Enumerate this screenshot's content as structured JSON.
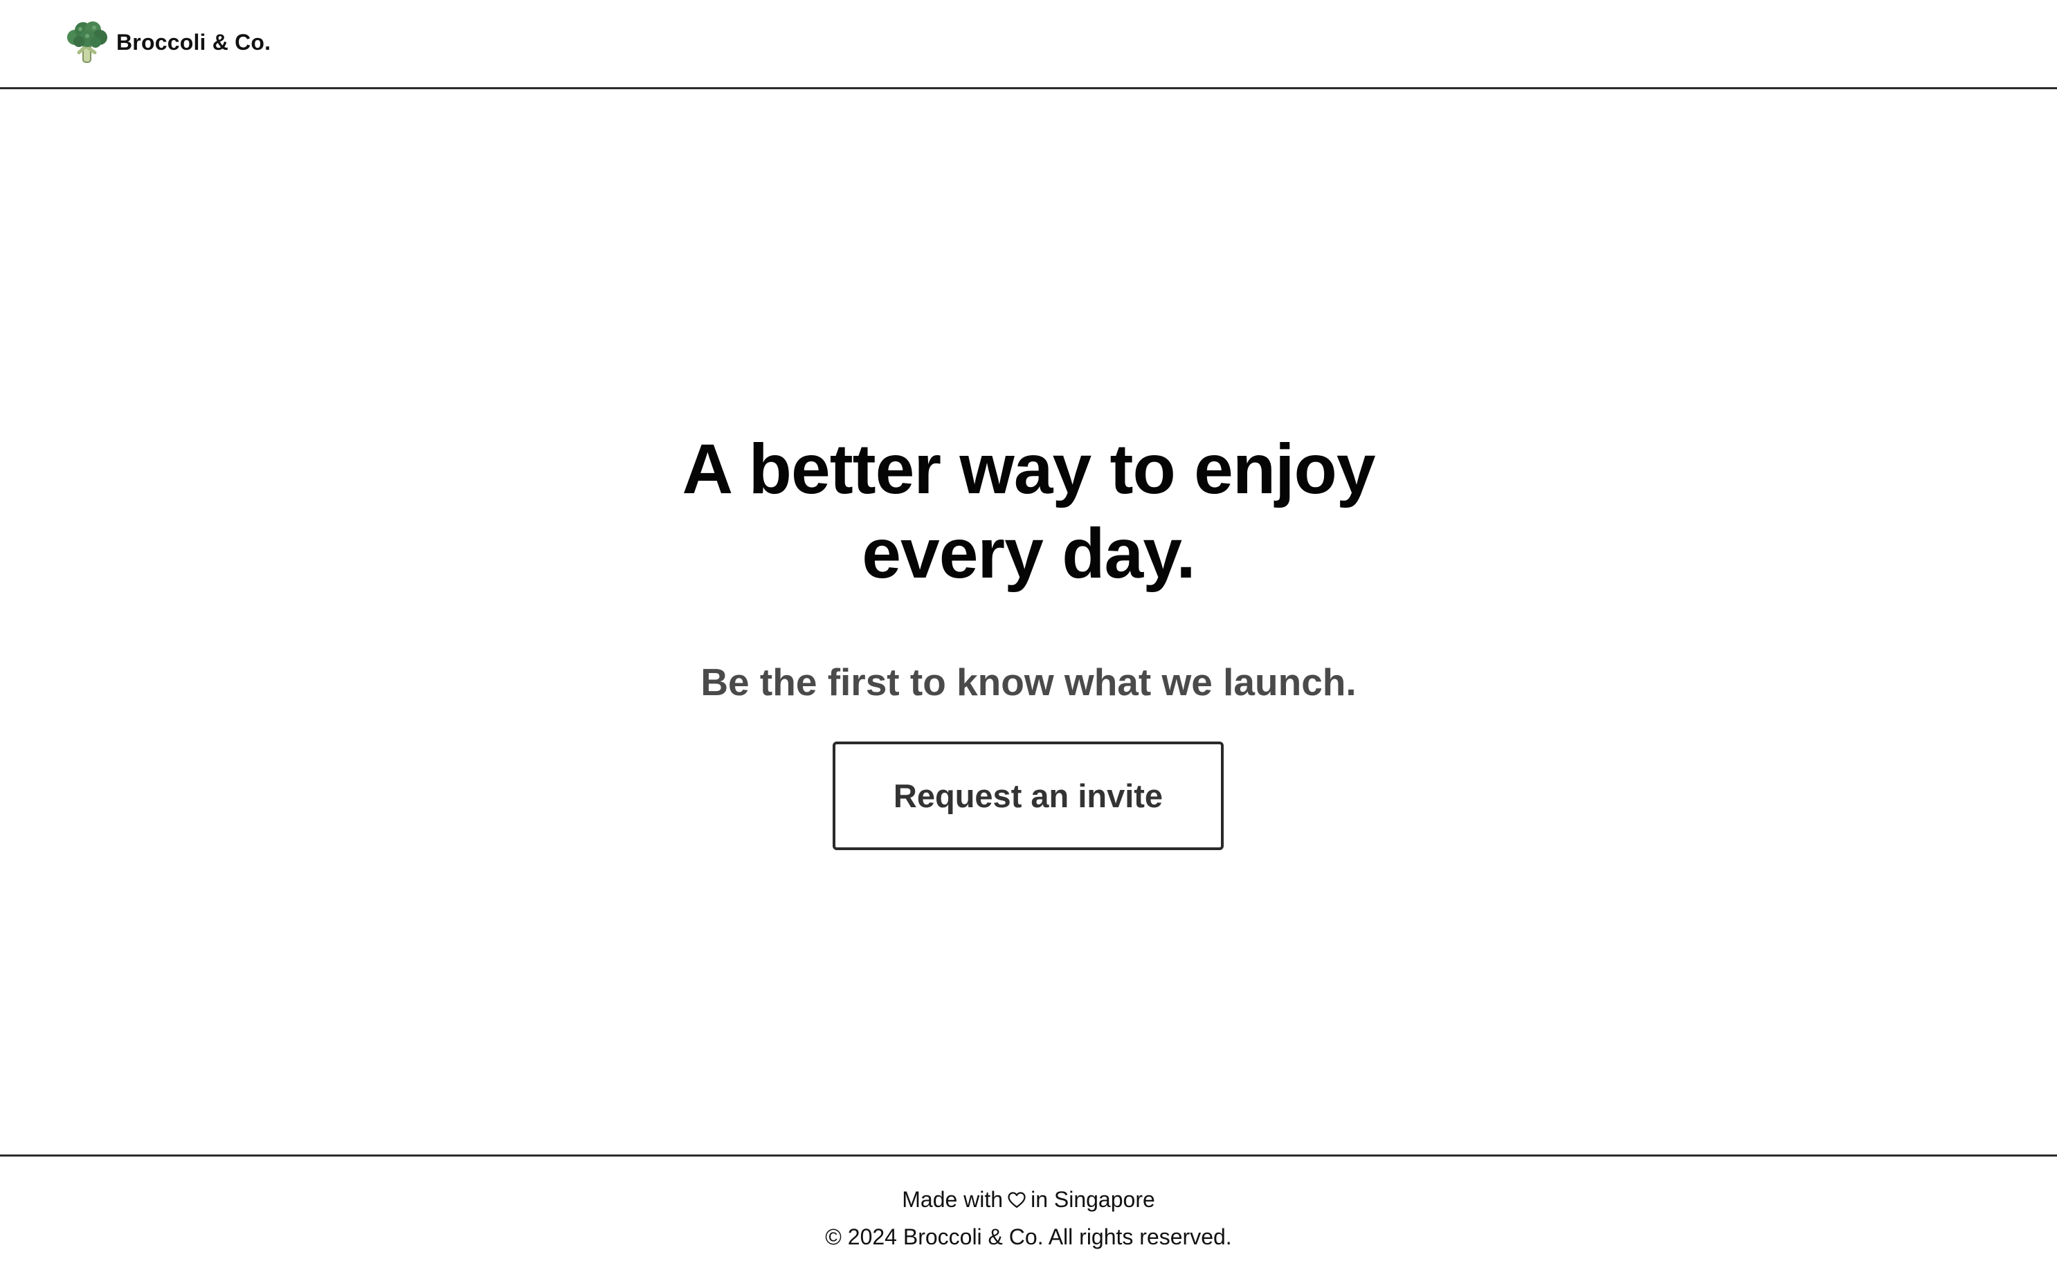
{
  "header": {
    "brand_name": "Broccoli & Co.",
    "logo_icon": "broccoli-icon"
  },
  "hero": {
    "headline_line1": "A better way to enjoy",
    "headline_line2": "every day.",
    "subhead": "Be the first to know what we launch.",
    "cta_label": "Request an invite"
  },
  "footer": {
    "made_with_prefix": "Made with",
    "heart_icon": "heart-icon",
    "made_with_suffix": "in Singapore",
    "copyright": "© 2024 Broccoli & Co. All rights reserved."
  },
  "colors": {
    "text": "#050505",
    "subhead": "#4a4a4a",
    "button_text": "#333333",
    "border": "#2b2b2b",
    "broccoli_green": "#3f7a4a"
  }
}
